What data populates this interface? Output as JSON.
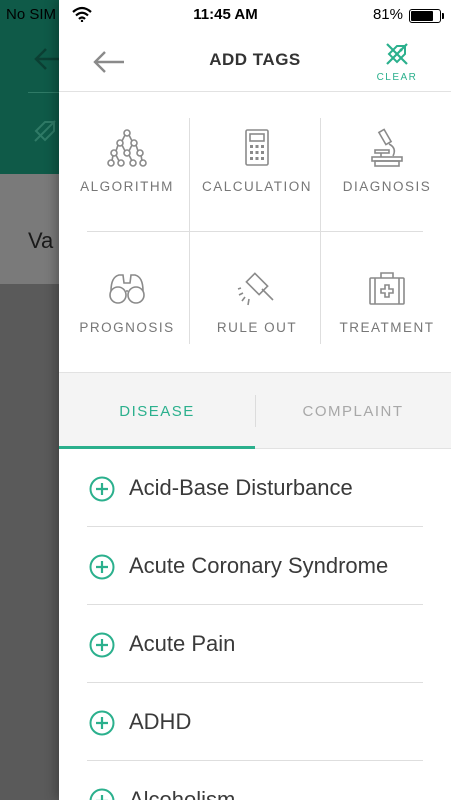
{
  "status_bar": {
    "carrier": "No SIM",
    "time": "11:45 AM",
    "battery_percent": "81%",
    "battery_level": 0.81
  },
  "background": {
    "partial_text": "Va"
  },
  "header": {
    "title": "ADD TAGS",
    "clear_label": "CLEAR",
    "accent_color": "#2bb08d"
  },
  "tag_types": [
    {
      "label": "ALGORITHM",
      "icon": "algorithm-icon"
    },
    {
      "label": "CALCULATION",
      "icon": "calculator-icon"
    },
    {
      "label": "DIAGNOSIS",
      "icon": "microscope-icon"
    },
    {
      "label": "PROGNOSIS",
      "icon": "binoculars-icon"
    },
    {
      "label": "RULE OUT",
      "icon": "gavel-icon"
    },
    {
      "label": "TREATMENT",
      "icon": "medical-kit-icon"
    }
  ],
  "tabs": [
    {
      "label": "DISEASE",
      "active": true
    },
    {
      "label": "COMPLAINT",
      "active": false
    }
  ],
  "diseases": [
    {
      "label": "Acid-Base Disturbance"
    },
    {
      "label": "Acute Coronary Syndrome"
    },
    {
      "label": "Acute Pain"
    },
    {
      "label": "ADHD"
    },
    {
      "label": "Alcoholism"
    }
  ]
}
